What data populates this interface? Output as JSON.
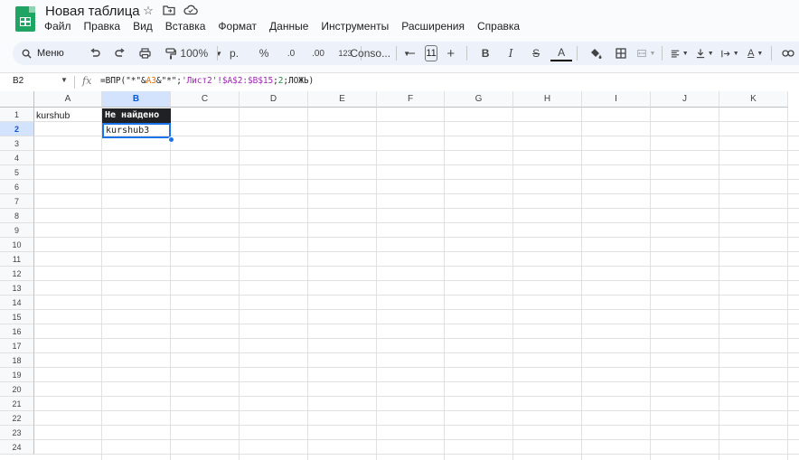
{
  "doc": {
    "title": "Новая таблица"
  },
  "menu": [
    "Файл",
    "Правка",
    "Вид",
    "Вставка",
    "Формат",
    "Данные",
    "Инструменты",
    "Расширения",
    "Справка"
  ],
  "toolbar": {
    "menu_label": "Меню",
    "zoom": "100%",
    "currency": "р.",
    "percent": "%",
    "dec_decrease": ".0",
    "dec_increase": ".00",
    "number_format": "123",
    "font": "Conso...",
    "font_size": "11"
  },
  "formula_bar": {
    "cell_ref": "B2",
    "fx": "fx",
    "formula_parts": [
      {
        "t": "=ВПР(\"*\"&",
        "c": ""
      },
      {
        "t": "A3",
        "c": "ref1"
      },
      {
        "t": "&\"*\";",
        "c": ""
      },
      {
        "t": "'Лист2'!$A$2:$B$15",
        "c": "ref2"
      },
      {
        "t": ";",
        "c": ""
      },
      {
        "t": "2",
        "c": "num"
      },
      {
        "t": ";ЛОЖЬ)",
        "c": ""
      }
    ]
  },
  "columns": [
    "A",
    "B",
    "C",
    "D",
    "E",
    "F",
    "G",
    "H",
    "I",
    "J",
    "K"
  ],
  "rows": [
    "1",
    "2",
    "3",
    "4",
    "5",
    "6",
    "7",
    "8",
    "9",
    "10",
    "11",
    "12",
    "13",
    "14",
    "15",
    "16",
    "17",
    "18",
    "19",
    "20",
    "21",
    "22",
    "23",
    "24"
  ],
  "selected": {
    "column": "B",
    "row": "2"
  },
  "cells": {
    "A1": "kurshub",
    "B1": "Не найдено",
    "B2": "kurshub3"
  }
}
